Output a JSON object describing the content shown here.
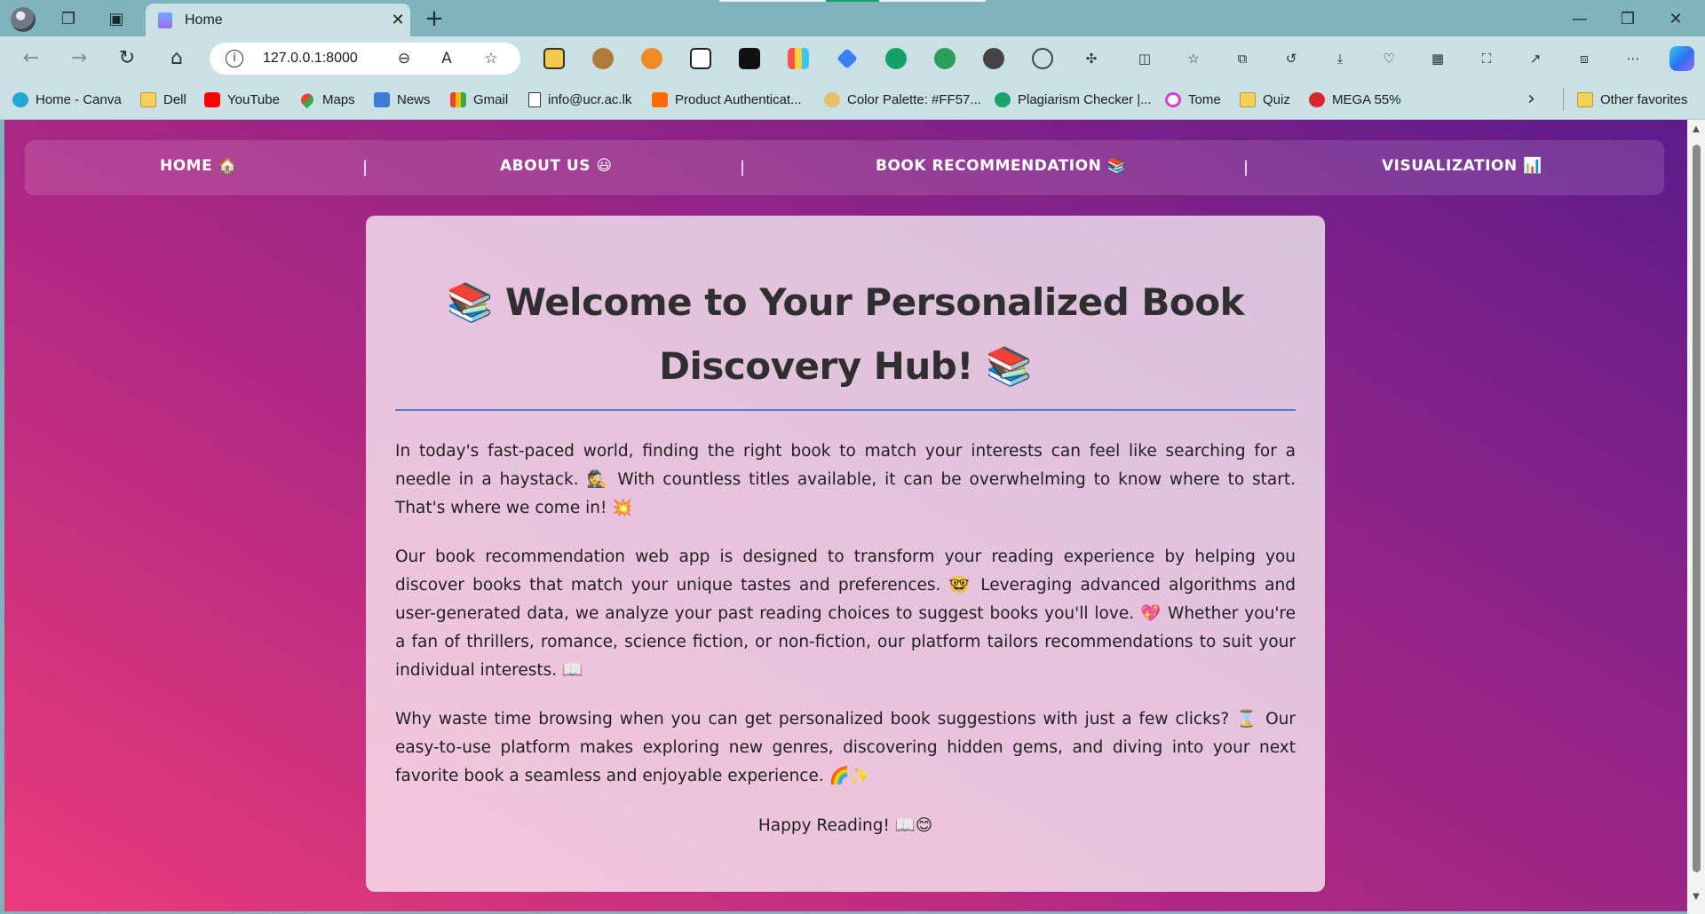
{
  "browser": {
    "tab_title": "Home",
    "tab_close": "✕",
    "new_tab": "+",
    "window_controls": {
      "minimize": "—",
      "restore": "❐",
      "close": "✕"
    },
    "nav": {
      "back": "←",
      "forward": "→",
      "reload": "↻",
      "home": "⌂"
    },
    "url": "127.0.0.1:8000",
    "info_glyph": "i",
    "omnibox_actions": {
      "zoom": "⊖",
      "read_aloud": "A",
      "favorite": "☆"
    },
    "extensions": [
      "ext-1",
      "ext-2",
      "ext-3",
      "ext-4",
      "ext-5",
      "ext-6",
      "ext-7",
      "ext-8",
      "ext-9",
      "ext-10",
      "ext-11"
    ],
    "toolbar_glyphs": {
      "puzzle": "✣",
      "split": "◫",
      "favorites": "☆",
      "collections": "⧉",
      "history": "↺",
      "downloads": "⤓",
      "performance": "♡",
      "apps": "▦",
      "screenshot": "⛶",
      "share": "↗",
      "workspace": "⧈",
      "more": "⋯"
    },
    "favorites": [
      {
        "label": "Home - Canva",
        "icon": "canva"
      },
      {
        "label": "Dell",
        "icon": "folder"
      },
      {
        "label": "YouTube",
        "icon": "yt"
      },
      {
        "label": "Maps",
        "icon": "maps"
      },
      {
        "label": "News",
        "icon": "news"
      },
      {
        "label": "Gmail",
        "icon": "gmail"
      },
      {
        "label": "info@ucr.ac.lk",
        "icon": "doc"
      },
      {
        "label": "Product Authenticat...",
        "icon": "mi"
      },
      {
        "label": "Color Palette: #FF57...",
        "icon": "cp"
      },
      {
        "label": "Plagiarism Checker |...",
        "icon": "plag"
      },
      {
        "label": "Tome",
        "icon": "tome"
      },
      {
        "label": "Quiz",
        "icon": "folder"
      },
      {
        "label": "MEGA 55%",
        "icon": "mega"
      }
    ],
    "favorites_more": "›",
    "other_favorites": "Other favorites"
  },
  "site_nav": {
    "items": [
      "HOME 🏠",
      "ABOUT US 😃",
      "BOOK RECOMMENDATION 📚",
      "VISUALIZATION 📊"
    ],
    "divider": "|"
  },
  "content": {
    "heading": "📚 Welcome to Your Personalized Book Discovery Hub! 📚",
    "paragraphs": [
      "In today's fast-paced world, finding the right book to match your interests can feel like searching for a needle in a haystack. 🕵️ With countless titles available, it can be overwhelming to know where to start. That's where we come in! 💥",
      "Our book recommendation web app is designed to transform your reading experience by helping you discover books that match your unique tastes and preferences. 🤓 Leveraging advanced algorithms and user-generated data, we analyze your past reading choices to suggest books you'll love. 💖 Whether you're a fan of thrillers, romance, science fiction, or non-fiction, our platform tailors recommendations to suit your individual interests. 📖",
      "Why waste time browsing when you can get personalized book suggestions with just a few clicks? ⌛ Our easy-to-use platform makes exploring new genres, discovering hidden gems, and diving into your next favorite book a seamless and enjoyable experience. 🌈✨"
    ],
    "closing": "Happy Reading! 📖😊"
  },
  "colors": {
    "gradient_start": "#ea3b7b",
    "gradient_end": "#5d1b8c",
    "heading_rule": "#4a7fd4"
  }
}
